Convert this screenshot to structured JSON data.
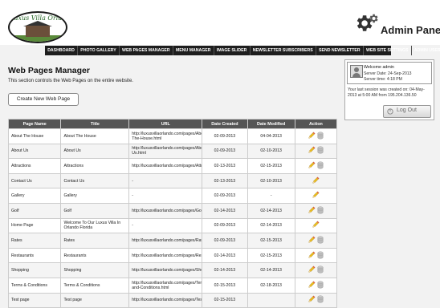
{
  "logo": {
    "text": "Luxus Villa Orlando"
  },
  "brand": {
    "title": "Admin Panel"
  },
  "nav": [
    "DASHBOARD",
    "PHOTO GALLERY",
    "WEB PAGES MANAGER",
    "MENU MANAGER",
    "IMAGE SLIDER",
    "NEWSLETTER SUBSCRIBERS",
    "SEND NEWSLETTER",
    "WEB SITE SETTINGS",
    "ADMIN USERS"
  ],
  "page": {
    "title": "Web Pages Manager",
    "description": "This section controls the Web Pages on the entire website.",
    "create_button": "Create New Web Page"
  },
  "session": {
    "welcome": "Welcome admin",
    "server_date": "Server Date: 24-Sep-2013",
    "server_time": "Server time: 4:18 PM",
    "last_session": "Your last session was created on: 04-May-2013 at 5:00 AM from 195.204.136.50",
    "logout_label": "Log Out"
  },
  "table": {
    "headers": [
      "Page Name",
      "Title",
      "URL",
      "Date Created",
      "Date Modified",
      "Action"
    ],
    "rows": [
      {
        "name": "About The House",
        "title": "About The House",
        "url": "http://luxusvillaorlando.com/pages/About-The-House.html",
        "created": "02-09-2013",
        "modified": "04-04-2013",
        "delete": true
      },
      {
        "name": "About Us",
        "title": "About Us",
        "url": "http://luxusvillaorlando.com/pages/About-Us.html",
        "created": "02-09-2013",
        "modified": "02-10-2013",
        "delete": true
      },
      {
        "name": "Attractions",
        "title": "Attractions",
        "url": "http://luxusvillaorlando.com/pages/Attractions.html",
        "created": "02-13-2013",
        "modified": "02-15-2013",
        "delete": true
      },
      {
        "name": "Contact Us",
        "title": "Contact Us",
        "url": "-",
        "created": "02-13-2013",
        "modified": "02-10-2013",
        "delete": false
      },
      {
        "name": "Gallery",
        "title": "Gallery",
        "url": "-",
        "created": "02-09-2013",
        "modified": "-",
        "delete": false
      },
      {
        "name": "Golf",
        "title": "Golf",
        "url": "http://luxusvillaorlando.com/pages/Golf.html",
        "created": "02-14-2013",
        "modified": "02-14-2013",
        "delete": true
      },
      {
        "name": "Home Page",
        "title": "Welcome To Our Luxus Villa In Orlando Florida",
        "url": "-",
        "created": "02-09-2013",
        "modified": "02-14-2013",
        "delete": false
      },
      {
        "name": "Rates",
        "title": "Rates",
        "url": "http://luxusvillaorlando.com/pages/Rates.html",
        "created": "02-09-2013",
        "modified": "02-15-2013",
        "delete": true
      },
      {
        "name": "Restaurants",
        "title": "Restaurants",
        "url": "http://luxusvillaorlando.com/pages/Restaurants.html",
        "created": "02-14-2013",
        "modified": "02-15-2013",
        "delete": true
      },
      {
        "name": "Shopping",
        "title": "Shopping",
        "url": "http://luxusvillaorlando.com/pages/Shopping.html",
        "created": "02-14-2013",
        "modified": "02-14-2013",
        "delete": true
      },
      {
        "name": "Terms & Conditions",
        "title": "Terms & Conditions",
        "url": "http://luxusvillaorlando.com/pages/Terms-and-Conditions.html",
        "created": "02-15-2013",
        "modified": "02-18-2013",
        "delete": true
      },
      {
        "name": "Test page",
        "title": "Test page",
        "url": "http://luxusvillaorlando.com/pages/Test-",
        "created": "02-15-2013",
        "modified": "",
        "delete": true
      }
    ]
  },
  "icons": {
    "gear": "gear-icon",
    "pencil": "pencil-icon",
    "delete": "database-delete-icon",
    "user": "user-avatar-icon",
    "logout": "logout-icon"
  }
}
